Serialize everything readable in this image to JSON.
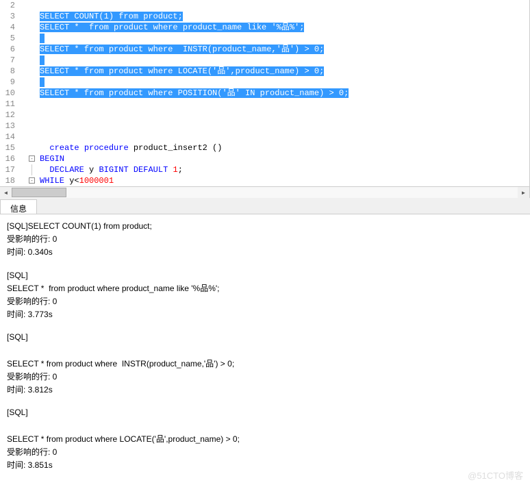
{
  "editor": {
    "lines": [
      {
        "num": 2,
        "highlighted": false,
        "tokens": []
      },
      {
        "num": 3,
        "highlighted": true,
        "text": "SELECT COUNT(1) from product;"
      },
      {
        "num": 4,
        "highlighted": true,
        "text": "SELECT *  from product where product_name like '%品%';"
      },
      {
        "num": 5,
        "highlighted": true,
        "text": " "
      },
      {
        "num": 6,
        "highlighted": true,
        "text": "SELECT * from product where  INSTR(product_name,'品') > 0;"
      },
      {
        "num": 7,
        "highlighted": true,
        "text": " "
      },
      {
        "num": 8,
        "highlighted": true,
        "text": "SELECT * from product where LOCATE('品',product_name) > 0;"
      },
      {
        "num": 9,
        "highlighted": true,
        "text": " "
      },
      {
        "num": 10,
        "highlighted": true,
        "text": "SELECT * from product where POSITION('品' IN product_name) > 0;"
      },
      {
        "num": 11,
        "highlighted": false,
        "tokens": []
      },
      {
        "num": 12,
        "highlighted": false,
        "tokens": []
      },
      {
        "num": 13,
        "highlighted": false,
        "tokens": []
      },
      {
        "num": 14,
        "highlighted": false,
        "tokens": []
      },
      {
        "num": 15,
        "highlighted": false,
        "tokens": [
          {
            "t": "  ",
            "c": ""
          },
          {
            "t": "create",
            "c": "kw"
          },
          {
            "t": " ",
            "c": ""
          },
          {
            "t": "procedure",
            "c": "kw"
          },
          {
            "t": " product_insert2 ()",
            "c": "id"
          }
        ]
      },
      {
        "num": 16,
        "highlighted": false,
        "fold": "minus",
        "tokens": [
          {
            "t": "BEGIN",
            "c": "kw"
          }
        ]
      },
      {
        "num": 17,
        "highlighted": false,
        "foldline": true,
        "tokens": [
          {
            "t": "  ",
            "c": ""
          },
          {
            "t": "DECLARE",
            "c": "kw"
          },
          {
            "t": " y ",
            "c": "id"
          },
          {
            "t": "BIGINT",
            "c": "kw"
          },
          {
            "t": " ",
            "c": ""
          },
          {
            "t": "DEFAULT",
            "c": "kw"
          },
          {
            "t": " ",
            "c": ""
          },
          {
            "t": "1",
            "c": "num"
          },
          {
            "t": ";",
            "c": "id"
          }
        ]
      },
      {
        "num": 18,
        "highlighted": false,
        "fold": "minus",
        "tokens": [
          {
            "t": "WHILE",
            "c": "kw"
          },
          {
            "t": " y<",
            "c": "id"
          },
          {
            "t": "1000001",
            "c": "num"
          }
        ]
      }
    ]
  },
  "tab": {
    "label": "信息"
  },
  "output": {
    "blocks": [
      {
        "lines": [
          "[SQL]SELECT COUNT(1) from product;",
          "受影响的行: 0",
          "时间: 0.340s"
        ]
      },
      {
        "lines": [
          "[SQL]",
          "SELECT *  from product where product_name like '%品%';",
          "受影响的行: 0",
          "时间: 3.773s"
        ]
      },
      {
        "lines": [
          "[SQL]",
          "",
          "SELECT * from product where  INSTR(product_name,'品') > 0;",
          "受影响的行: 0",
          "时间: 3.812s"
        ]
      },
      {
        "lines": [
          "[SQL]",
          "",
          "SELECT * from product where LOCATE('品',product_name) > 0;",
          "受影响的行: 0",
          "时间: 3.851s"
        ]
      }
    ]
  },
  "watermark": "@51CTO博客"
}
